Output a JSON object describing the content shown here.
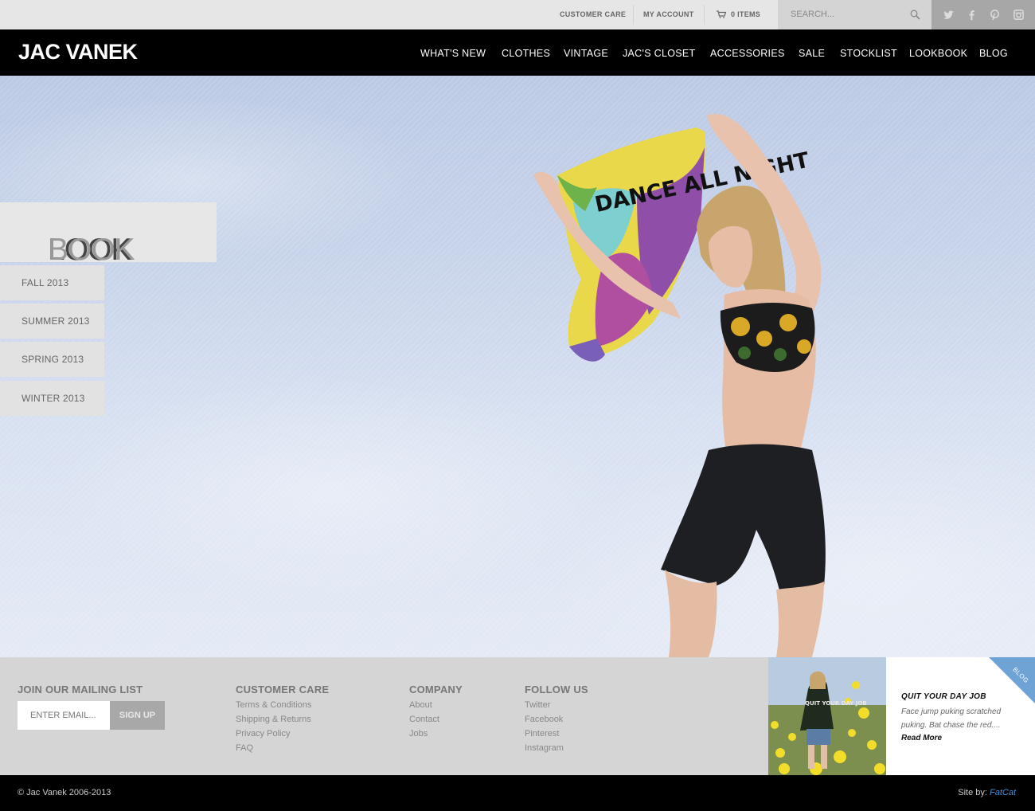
{
  "utility": {
    "customer_care": "CUSTOMER CARE",
    "my_account": "MY ACCOUNT",
    "cart": "0 ITEMS",
    "search_placeholder": "SEARCH..."
  },
  "social_icons": [
    "twitter-icon",
    "facebook-icon",
    "pinterest-icon",
    "instagram-icon"
  ],
  "brand": {
    "logo": "JAC VANEK"
  },
  "nav": [
    "WHAT'S NEW",
    "CLOTHES",
    "VINTAGE",
    "JAC'S CLOSET",
    "ACCESSORIES",
    "SALE",
    "STOCKLIST",
    "LOOKBOOK",
    "BLOG"
  ],
  "lookbook": {
    "title_dark": "LOOK",
    "title_light": "BOOK",
    "seasons": [
      "FALL 2013",
      "SUMMER 2013",
      "SPRING 2013",
      "WINTER 2013"
    ],
    "shirt_text": "DANCE ALL NIGHT"
  },
  "footer": {
    "mailing": {
      "heading": "JOIN OUR MAILING LIST",
      "placeholder": "ENTER EMAIL...",
      "button": "SIGN UP"
    },
    "customer_care": {
      "heading": "CUSTOMER CARE",
      "links": [
        "Terms & Conditions",
        "Shipping & Returns",
        "Privacy Policy",
        "FAQ"
      ]
    },
    "company": {
      "heading": "COMPANY",
      "links": [
        "About",
        "Contact",
        "Jobs"
      ]
    },
    "follow": {
      "heading": "FOLLOW US",
      "links": [
        "Twitter",
        "Facebook",
        "Pinterest",
        "Instagram"
      ]
    }
  },
  "blog": {
    "ribbon": "BLOG",
    "title": "QUIT YOUR DAY JOB",
    "excerpt": "Face jump puking scratched puking. Bat chase the red....",
    "read_more": "Read More",
    "image_text": "QUIT YOUR DAY JOB"
  },
  "bottom": {
    "copyright": "© Jac Vanek 2006-2013",
    "credit_prefix": "Site by:",
    "credit_link": "FatCat"
  },
  "colors": {
    "accent_blue": "#4a90d9",
    "ribbon_blue": "#6fa2d5",
    "nav_bg": "#000000"
  }
}
